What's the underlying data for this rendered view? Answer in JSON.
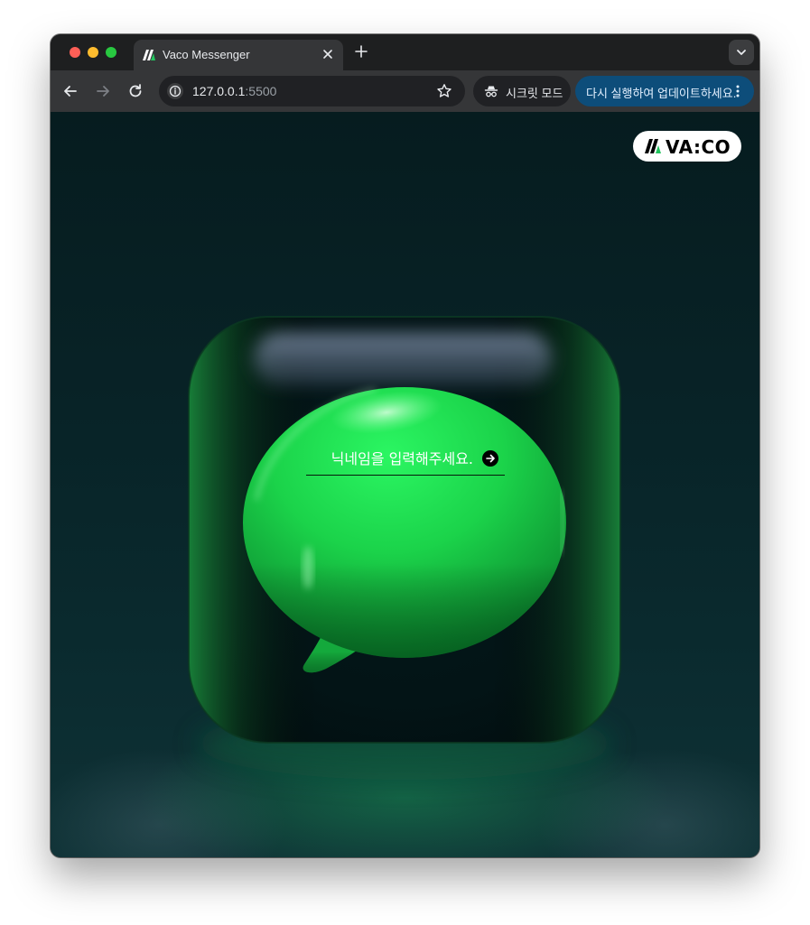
{
  "browser": {
    "tab": {
      "title": "Vaco Messenger"
    },
    "toolbar": {
      "url_host": "127.0.0.1",
      "url_port": ":5500",
      "incognito_label": "시크릿 모드",
      "update_label": "다시 실행하여 업데이트하세요."
    },
    "icons": {
      "back": "arrow-left-icon",
      "forward": "arrow-right-icon",
      "reload": "reload-icon",
      "site_info": "info-icon",
      "bookmark": "star-icon",
      "incognito": "incognito-icon",
      "menu": "kebab-menu-icon",
      "new_tab": "plus-icon",
      "tab_search": "chevron-down-icon"
    }
  },
  "page": {
    "logo_text": "VA:CO",
    "nickname": {
      "placeholder": "닉네임을 입력해주세요.",
      "value": ""
    },
    "colors": {
      "accent_green": "#22e35a",
      "background": "#082327"
    }
  }
}
